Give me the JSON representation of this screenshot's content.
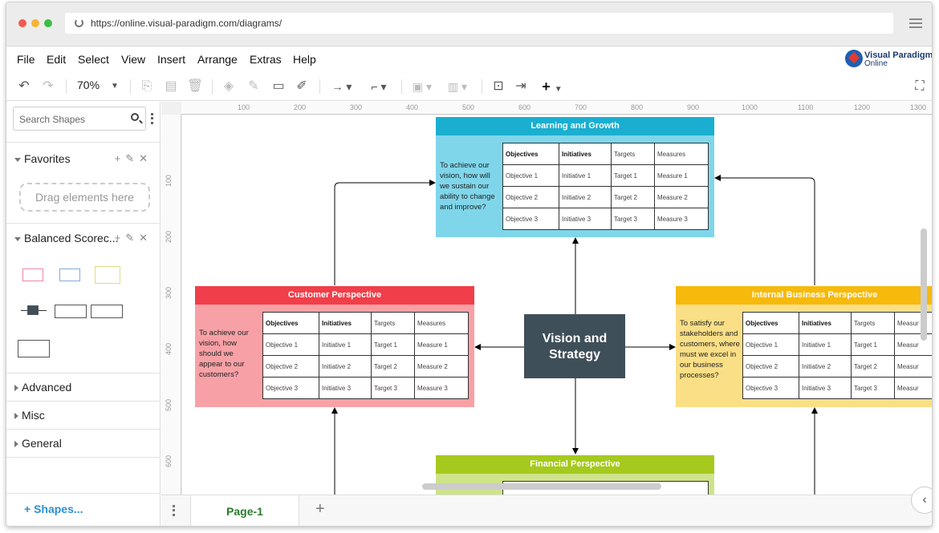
{
  "browser": {
    "url": "https://online.visual-paradigm.com/diagrams/"
  },
  "menu": [
    "File",
    "Edit",
    "Select",
    "View",
    "Insert",
    "Arrange",
    "Extras",
    "Help"
  ],
  "logo": {
    "line1": "Visual Paradigm",
    "line2": "Online"
  },
  "toolbar": {
    "zoom": "70%"
  },
  "sidebar": {
    "search_placeholder": "Search Shapes",
    "favorites": "Favorites",
    "drag_hint": "Drag elements here",
    "balanced": "Balanced Scorec...",
    "advanced": "Advanced",
    "misc": "Misc",
    "general": "General",
    "more_shapes": "+ Shapes..."
  },
  "rulers": {
    "top": [
      "100",
      "200",
      "300",
      "400",
      "500",
      "600",
      "700",
      "800",
      "900",
      "1000",
      "1100",
      "1200",
      "1300"
    ],
    "left": [
      "100",
      "200",
      "300",
      "400",
      "500",
      "600"
    ]
  },
  "diagram": {
    "learning": {
      "title": "Learning and Growth",
      "question": "To achieve our vision, how will we sustain our ability to change and improve?"
    },
    "customer": {
      "title": "Customer Perspective",
      "question": "To achieve our vision, how should we appear to our customers?"
    },
    "internal": {
      "title": "Internal Business Perspective",
      "question": "To satisfy our stakeholders and customers, where must we excel in our business processes?"
    },
    "financial": {
      "title": "Financial Perspective"
    },
    "vision": "Vision and Strategy",
    "table_header": [
      "Objectives",
      "Initiatives",
      "Targets",
      "Measures"
    ],
    "table_rows": [
      [
        "Objective 1",
        "Initiative 1",
        "Target 1",
        "Measure 1"
      ],
      [
        "Objective 2",
        "Initiative 2",
        "Target 2",
        "Measure 2"
      ],
      [
        "Objective 3",
        "Initiative 3",
        "Target 3",
        "Measure 3"
      ]
    ],
    "internal_measures_header": "Measur",
    "internal_measures_rows": [
      "Measur",
      "Measur",
      "Measur"
    ]
  },
  "pages": {
    "current": "Page-1"
  },
  "colors": {
    "learning_head": "#1aafd0",
    "learning_body": "#7fd6ea",
    "customer_head": "#f03f4a",
    "customer_body": "#f7a1a6",
    "internal_head": "#f6b90c",
    "internal_body": "#fadf87",
    "financial_head": "#a6c91e",
    "financial_body": "#cfe38a",
    "vision_bg": "#3f4f59"
  }
}
